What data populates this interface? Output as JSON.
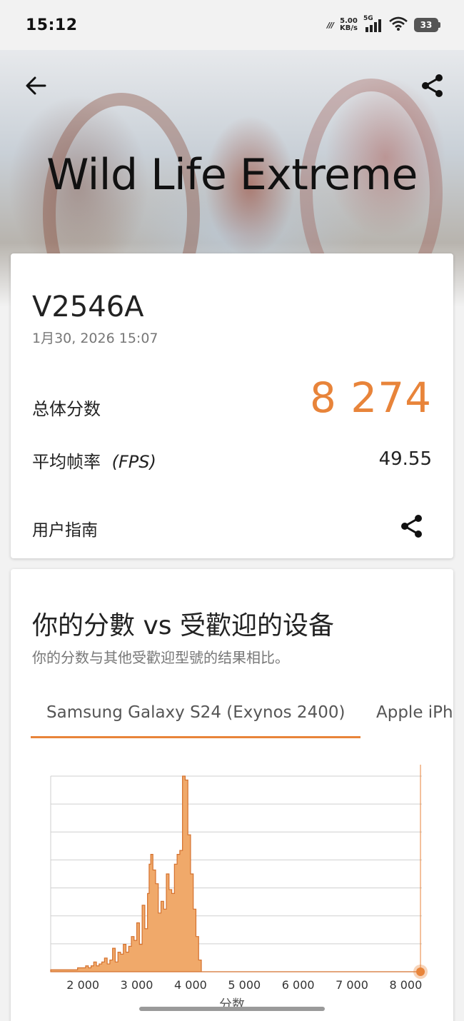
{
  "status_bar": {
    "time": "15:12",
    "speed_value": "5.00",
    "speed_unit": "KB/s",
    "network": "5G",
    "battery": "33",
    "icons": [
      "carrier-icon",
      "signal-icon",
      "wifi-icon",
      "battery-icon"
    ]
  },
  "header": {
    "title": "Wild Life Extreme",
    "back_icon": "arrow-left-icon",
    "share_icon": "share-icon"
  },
  "result": {
    "device": "V2546A",
    "date": "1月30, 2026 15:07",
    "overall_label": "总体分数",
    "overall_score": "8 274",
    "fps_label": "平均帧率",
    "fps_unit": "(FPS)",
    "fps_value": "49.55",
    "guide_label": "用户指南"
  },
  "compare": {
    "title": "你的分數 vs 受歡迎的设备",
    "subtitle": "你的分数与其他受歡迎型號的结果相比。",
    "tabs": [
      {
        "label": "Samsung Galaxy S24 (Exynos 2400)",
        "selected": true
      },
      {
        "label": "Apple iPhone",
        "selected": false
      }
    ]
  },
  "colors": {
    "accent": "#e8843a",
    "histogram_fill": "#f0a96a",
    "histogram_stroke": "#d4712e"
  },
  "chart_data": {
    "type": "area",
    "xlabel": "分数",
    "x_ticks": [
      "2 000",
      "3 000",
      "4 000",
      "5 000",
      "6 000",
      "7 000",
      "8 000"
    ],
    "xlim": [
      1400,
      8300
    ],
    "ylim": [
      0,
      100
    ],
    "grid": true,
    "your_score": 8274,
    "x": [
      1400,
      1500,
      1600,
      1700,
      1800,
      1900,
      2000,
      2050,
      2100,
      2150,
      2200,
      2250,
      2300,
      2350,
      2400,
      2450,
      2500,
      2550,
      2600,
      2650,
      2700,
      2750,
      2800,
      2850,
      2900,
      2950,
      3000,
      3050,
      3100,
      3150,
      3200,
      3230,
      3260,
      3300,
      3350,
      3400,
      3450,
      3500,
      3550,
      3600,
      3650,
      3700,
      3750,
      3800,
      3850,
      3900,
      3950,
      4000,
      4050,
      4100,
      4150,
      4200,
      4250,
      4300,
      4350,
      4400,
      4450,
      4500,
      5000,
      6000,
      7000,
      8000,
      8300
    ],
    "y": [
      1,
      1,
      1,
      1,
      1,
      2,
      2,
      3,
      2,
      3,
      5,
      3,
      4,
      5,
      7,
      4,
      6,
      12,
      5,
      10,
      9,
      14,
      10,
      13,
      18,
      16,
      25,
      14,
      34,
      22,
      40,
      55,
      60,
      52,
      45,
      30,
      36,
      32,
      50,
      42,
      40,
      55,
      60,
      62,
      100,
      98,
      70,
      50,
      32,
      18,
      6,
      0,
      0,
      0,
      0,
      0,
      0,
      0,
      0,
      0,
      0,
      0,
      0
    ]
  }
}
